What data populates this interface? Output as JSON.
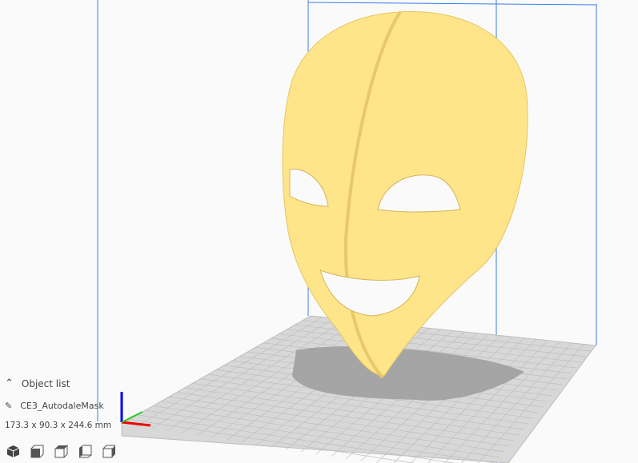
{
  "object_panel": {
    "toggle_label": "Object list",
    "object_name": "CE3_AutodaleMask",
    "dimensions": "173.3 x 90.3 x 244.6 mm"
  },
  "view_buttons": [
    {
      "icon": "view-3d-icon"
    },
    {
      "icon": "view-front-icon"
    },
    {
      "icon": "view-top-icon"
    },
    {
      "icon": "view-left-icon"
    },
    {
      "icon": "view-right-icon"
    }
  ],
  "colors": {
    "model": "#ffe58a",
    "volume": "#3a7bf0",
    "plate": "#d6d6d6"
  }
}
